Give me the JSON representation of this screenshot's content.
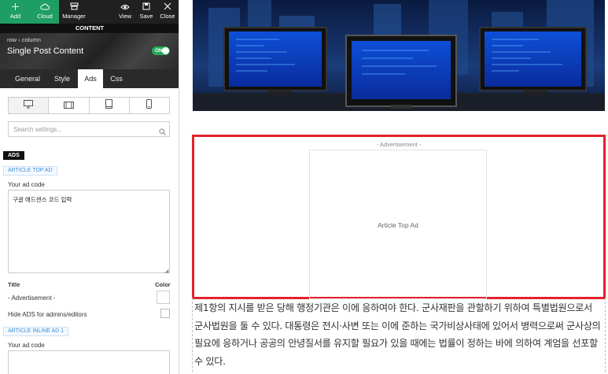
{
  "toolbar": {
    "add": "Add",
    "cloud": "Cloud",
    "manager": "Manager",
    "view": "View",
    "save": "Save",
    "close": "Close"
  },
  "content_bar": "CONTENT",
  "breadcrumb": "row › column",
  "page_title": "Single Post Content",
  "toggle_label": "ON",
  "tabs": [
    "General",
    "Style",
    "Ads",
    "Css"
  ],
  "active_tab": "Ads",
  "devices": [
    "desktop-icon",
    "tablet-landscape-icon",
    "tablet-icon",
    "mobile-icon"
  ],
  "search": {
    "placeholder": "Search settings..."
  },
  "ads_label": "ADS",
  "article_top_ad": {
    "section": "ARTICLE TOP AD",
    "code_label": "Your ad code",
    "code_value": "구글 애드센스 코드 입력"
  },
  "title_header": "Title",
  "color_header": "Color",
  "title_value": "- Advertisement -",
  "hide_ads_label": "Hide ADS for admins/editors",
  "article_inline_ad": {
    "section": "ARTICLE INLINE AD 1",
    "code_label": "Your ad code"
  },
  "preview": {
    "ad_heading": "- Advertisement -",
    "ad_placeholder": "Article Top Ad",
    "article_text": "제1항의 지시를 받은 당해 행정기관은 이에 응하여야 한다. 군사재판을 관할하기 위하여 특별법원으로서 군사법원을 둘 수 있다. 대통령은 전시·사변 또는 이에 준하는 국가비상사태에 있어서 병력으로써 군사상의 필요에 응하거나 공공의 안녕질서를 유지할 필요가 있을 때에는 법률이 정하는 바에 의하여 계엄을 선포할 수 있다."
  },
  "colors": {
    "toolbar_green": "#1e9e63",
    "toggle_green": "#27a85a",
    "highlight_red": "#e3222b",
    "section_blue": "#3a8fd9"
  }
}
